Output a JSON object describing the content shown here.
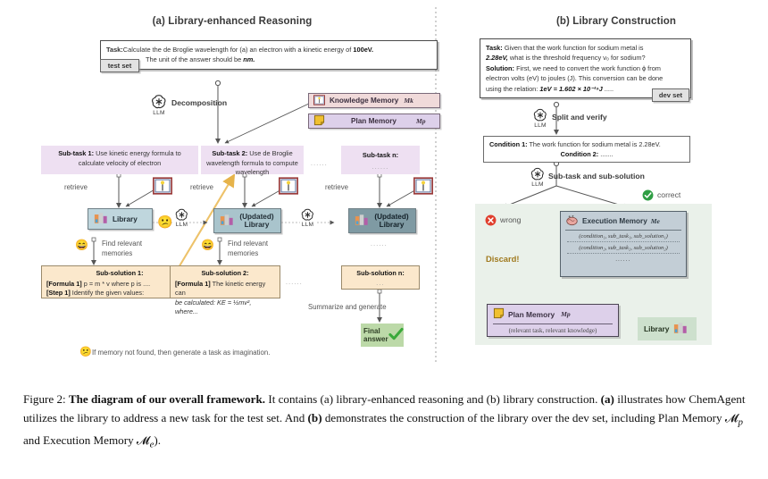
{
  "panels": {
    "a_title": "(a) Library-enhanced Reasoning",
    "b_title": "(b) Library Construction"
  },
  "left": {
    "task_label": "Task:",
    "task_text_1": "Calculate the de Broglie wavelength for (a) an electron with a kinetic energy of ",
    "task_bold_1": "100eV.",
    "task_text_2": "The unit of the answer should be ",
    "task_bold_2": "nm.",
    "tag_test_set": "test set",
    "llm_label": "LLM",
    "decomposition_label": "Decomposition",
    "knowledge_memory": "Knowledge Memory",
    "knowledge_memory_sym": "Mk",
    "plan_memory": "Plan Memory",
    "plan_memory_sym": "Mp",
    "subtasks": [
      {
        "head": "Sub-task 1:",
        "body": " Use kinetic energy formula to calculate velocity of electron"
      },
      {
        "head": "Sub-task 2:",
        "body": " Use de Broglie wavelength formula to compute wavelength"
      },
      {
        "head": "Sub-task n:",
        "body": "......"
      }
    ],
    "retrieve_label": "retrieve",
    "library_labels": [
      "Library",
      "(Updated) Library",
      "(Updated) Library"
    ],
    "find_relevant": "Find relevant memories",
    "subsolutions": [
      {
        "head": "Sub-solution 1:",
        "l1_b": "[Formula 1]",
        "l1_t": " p = m * v where p is ....",
        "l2_b": "[Step 1]",
        "l2_t": " Identify the given values:"
      },
      {
        "head": "Sub-solution 2:",
        "l1_b": "[Formula 1]",
        "l1_t": " The kinetic energy can",
        "l2_b": "",
        "l2_t": "be calculated: KE = ½mv², where..."
      },
      {
        "head": "Sub-solution n:",
        "l1_b": "",
        "l1_t": "...",
        "l2_b": "",
        "l2_t": ""
      }
    ],
    "summarize_label": "Summarize and generate",
    "final_answer": "Final answer",
    "footnote": "If memory not found, then generate a task as imagination.",
    "ellipsis": "......"
  },
  "right": {
    "task_label": "Task:",
    "task_line1": " Given that the work function for sodium metal is",
    "task_line2_b": "2.28eV,",
    "task_line2": " what is the threshold frequency ν₀ for sodium?",
    "solution_label": "Solution:",
    "solution_line1": " First, we need to convert the work function ϕ from",
    "solution_line2": "electron volts (eV) to joules (J). This conversion can be done",
    "solution_line3": "using the relation: ",
    "solution_line3_b": "1eV = 1.602 × 10⁻¹⁹J",
    "solution_line3_tail": " .....",
    "tag_dev_set": "dev set",
    "llm_label": "LLM",
    "split_verify": "Split and verify",
    "condition1_b": "Condition 1:",
    "condition1_t": " The work function for sodium metal is 2.28eV.",
    "condition2_b": "Condition 2:",
    "condition2_t": " .......",
    "subtask_subsolution": "Sub-task and sub-solution",
    "correct_label": "correct",
    "wrong_label": "wrong",
    "discard_label": "Discard!",
    "execution_memory": "Execution Memory",
    "execution_memory_sym": "Me",
    "exec_lines": [
      "(condition₁, sub_task₁, sub_solution₁)",
      "(condition₂, sub_task₂, sub_solution₂)",
      "......"
    ],
    "plan_memory": "Plan Memory",
    "plan_memory_sym": "Mp",
    "plan_sub": "(relevant task, relevant knowledge)",
    "library_label": "Library"
  },
  "caption": {
    "fig_no": "Figure 2: ",
    "bold_title": "The diagram of our overall framework.",
    "rest_1": " It contains (a) library-enhanced reasoning and (b) library construction. ",
    "b_a": "(a)",
    "rest_2": " illustrates how ChemAgent utilizes the library to address a new task for the test set.  And ",
    "b_b": "(b)",
    "rest_3": " demonstrates the construction of the library over the dev set, including Plan Memory 𝓜",
    "sub_p": "p",
    "rest_4": " and Execution Memory 𝓜",
    "sub_e": "e",
    "rest_5": ")."
  },
  "colors": {
    "subtask_bg": "#eee0f2",
    "subsolution_bg": "#fbe8cc",
    "library_bg": "#bfd6dd",
    "knowledge_bg": "#f0dada",
    "plan_bg": "#ddd0ea",
    "green_panel": "#eaf1ea",
    "correct_green": "#2f9e44",
    "wrong_red": "#e03e2d",
    "discard_brown": "#a07a1f",
    "final_green": "#bcd9a8"
  },
  "icons": {
    "llm": "openai-logo-icon",
    "book": "open-book-icon",
    "sticky": "sticky-note-icon",
    "library": "library-books-icon",
    "brain": "brain-icon",
    "check": "check-circle-icon",
    "cross": "cross-circle-icon",
    "neutral": "neutral-face-emoji",
    "happy": "grinning-face-emoji"
  }
}
